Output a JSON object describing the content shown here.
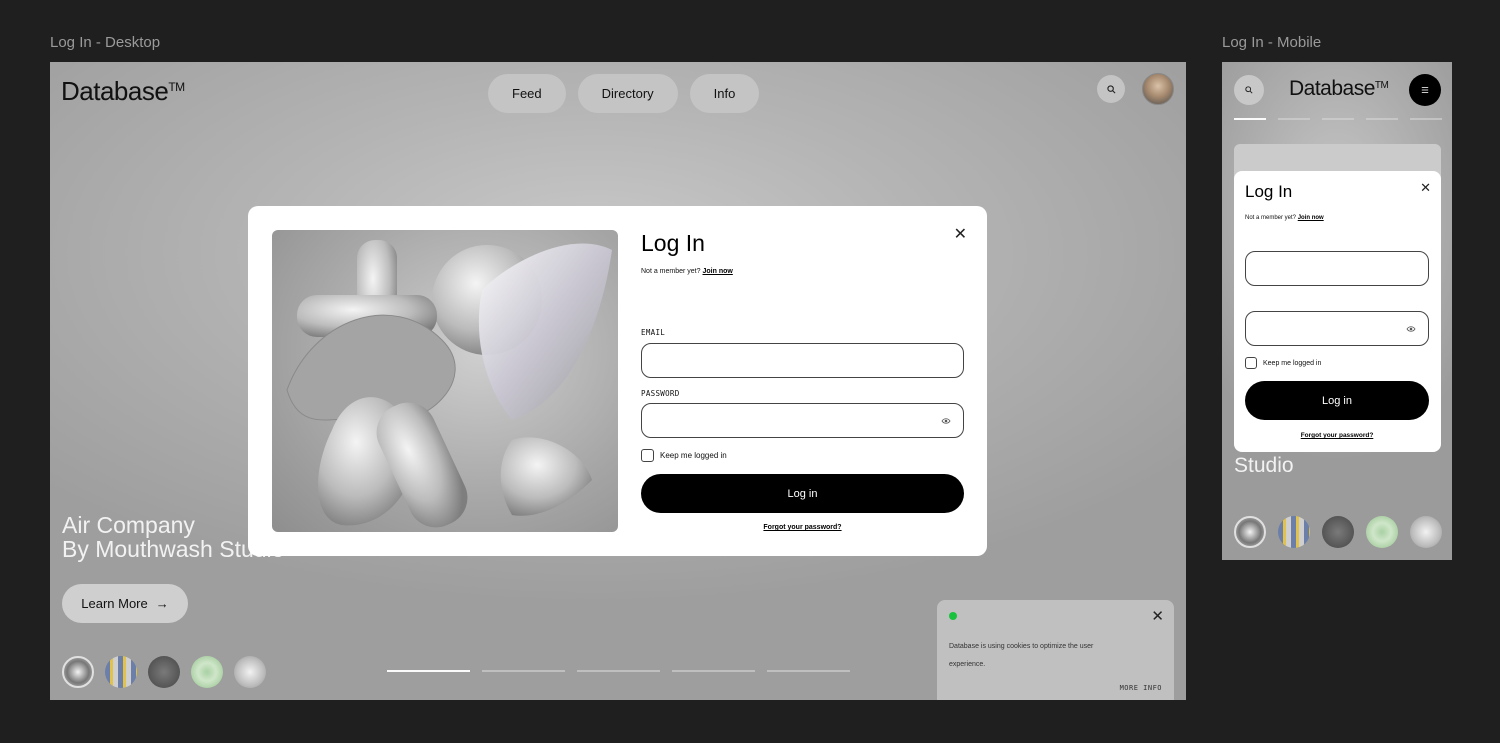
{
  "labels": {
    "desktop": "Log In - Desktop",
    "mobile": "Log In - Mobile"
  },
  "site": {
    "logo": "Database",
    "tm": "TM"
  },
  "nav": [
    "Feed",
    "Directory",
    "Info"
  ],
  "hero": {
    "line1": "Air Company",
    "line2": "By Mouthwash Studio",
    "cta": "Learn More",
    "mobile_line": "Studio"
  },
  "cookie": {
    "text": "Database is using cookies to optimize the user experience.",
    "more": "MORE INFO"
  },
  "login": {
    "title": "Log In",
    "not_member": "Not a member yet?",
    "join": "Join now",
    "email_label": "EMAIL",
    "password_label": "PASSWORD",
    "keep_logged": "Keep me logged in",
    "button": "Log in",
    "forgot": "Forgot your password?"
  },
  "icons": {
    "search": "search-icon",
    "close": "close-icon",
    "eye": "eye-icon",
    "menu": "menu-icon",
    "arrow": "arrow-right-icon"
  },
  "colors": {
    "status_dot": "#18c23c",
    "button": "#000000"
  }
}
